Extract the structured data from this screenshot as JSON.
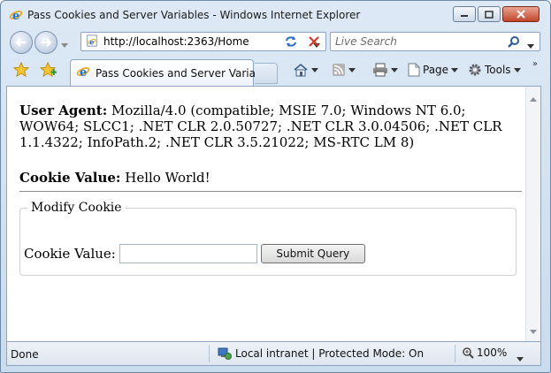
{
  "window": {
    "title": "Pass Cookies and Server Variables - Windows Internet Explorer"
  },
  "address_bar": {
    "url": "http://localhost:2363/Home"
  },
  "search": {
    "placeholder": "Live Search"
  },
  "tab": {
    "label": "Pass Cookies and Server Variables"
  },
  "command_bar": {
    "page_label": "Page",
    "tools_label": "Tools"
  },
  "content": {
    "user_agent_label": "User Agent:",
    "user_agent_value": " Mozilla/4.0 (compatible; MSIE 7.0; Windows NT 6.0; WOW64; SLCC1; .NET CLR 2.0.50727; .NET CLR 3.0.04506; .NET CLR 1.1.4322; InfoPath.2; .NET CLR 3.5.21022; MS-RTC LM 8)",
    "cookie_label": "Cookie Value:",
    "cookie_value": " Hello World!",
    "fieldset_legend": "Modify Cookie",
    "form_label": "Cookie Value:",
    "form_input_value": "",
    "submit_label": "Submit Query"
  },
  "status": {
    "done": "Done",
    "zone": "Local intranet | Protected Mode: On",
    "zoom": "100%"
  },
  "icons": {
    "ie_logo": "ie-logo-icon",
    "back": "back-arrow-icon",
    "forward": "forward-arrow-icon",
    "refresh": "refresh-icon",
    "stop": "stop-icon",
    "search": "magnifier-icon",
    "favorites": "star-icon",
    "add_favorite": "add-favorite-icon",
    "home": "home-icon",
    "feeds": "rss-feed-icon",
    "print": "printer-icon",
    "page": "page-icon",
    "tools": "gear-icon",
    "zone": "computer-network-icon",
    "zoom": "zoom-magnifier-icon"
  },
  "colors": {
    "chrome_top": "#dde9f5",
    "chrome_bottom": "#c9dbee",
    "close_button": "#c2452b",
    "page_background": "#ffffff"
  }
}
